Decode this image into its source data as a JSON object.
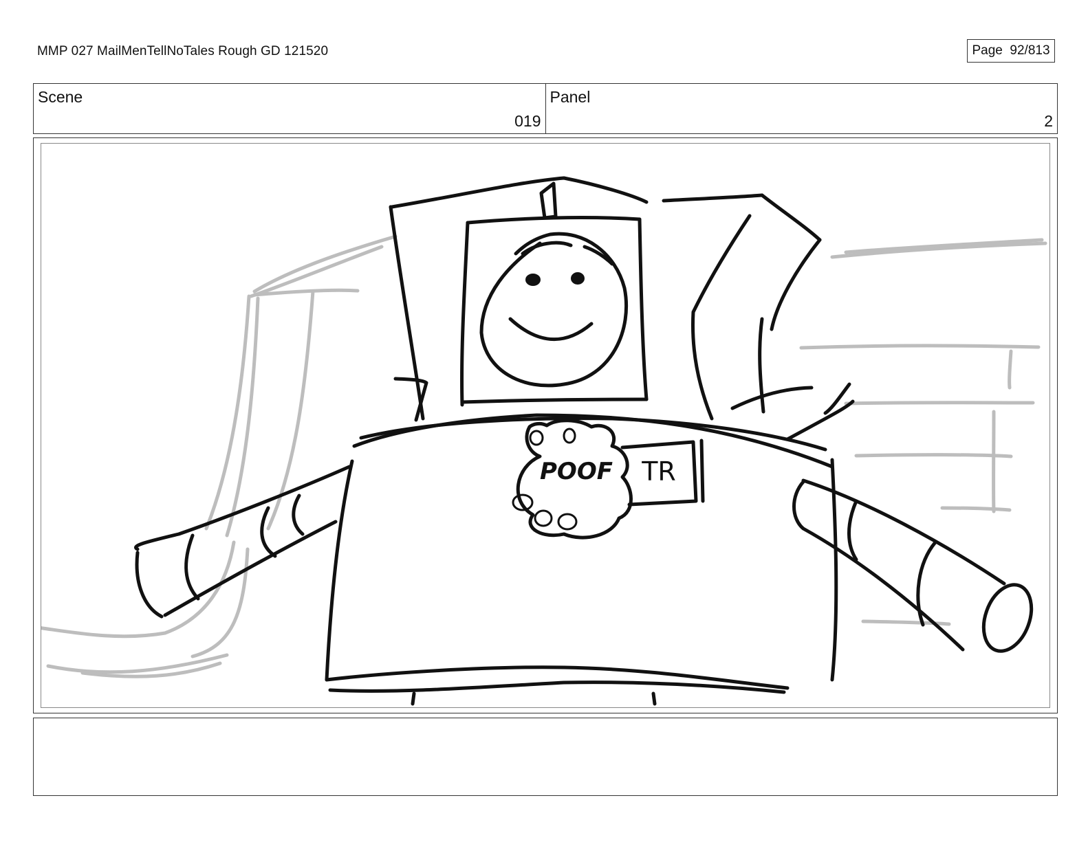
{
  "header": {
    "title": "MMP 027 MailMenTellNoTales Rough GD 121520",
    "page_label": "Page",
    "page_number": "92/813"
  },
  "info": {
    "scene_label": "Scene",
    "scene_value": "019",
    "panel_label": "Panel",
    "panel_value": "2"
  },
  "notes": {
    "text": ""
  },
  "sketch": {
    "badge_text": "POOF",
    "tag_text": "TR",
    "ink_color": "#111111",
    "background_line_color": "#bdbdbd"
  }
}
